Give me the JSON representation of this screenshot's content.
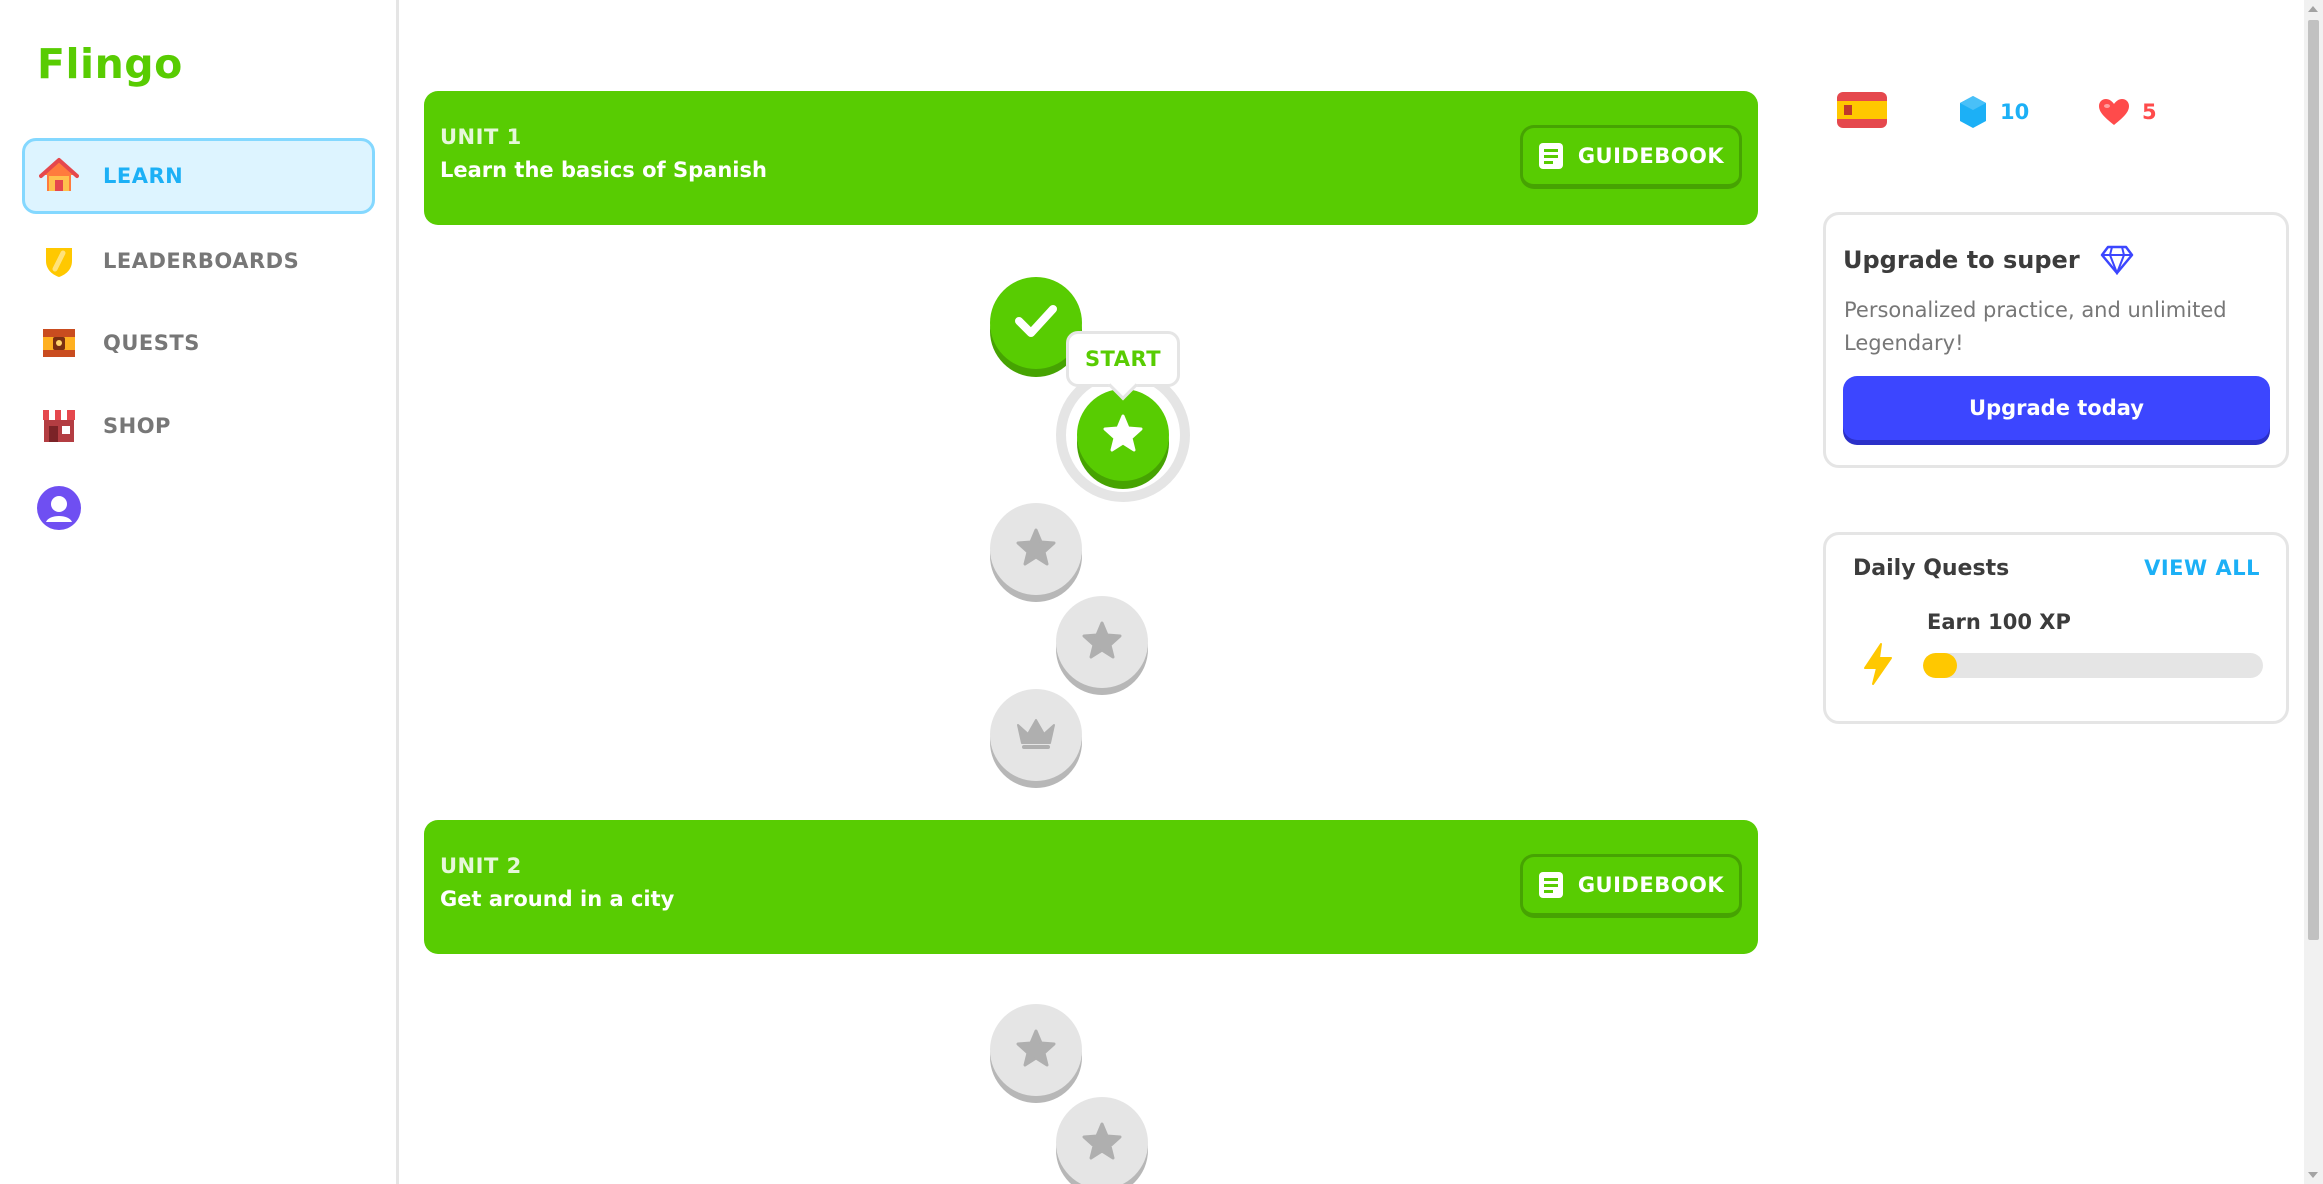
{
  "app": {
    "logo": "Flingo"
  },
  "sidebar": {
    "items": [
      {
        "label": "LEARN",
        "icon": "home-icon",
        "active": true
      },
      {
        "label": "LEADERBOARDS",
        "icon": "shield-icon"
      },
      {
        "label": "QUESTS",
        "icon": "chest-icon"
      },
      {
        "label": "SHOP",
        "icon": "shop-icon"
      },
      {
        "label": "",
        "icon": "profile-icon"
      }
    ]
  },
  "units": [
    {
      "title": "UNIT 1",
      "subtitle": "Learn the basics of Spanish",
      "guidebook_label": "GUIDEBOOK",
      "lessons": [
        "completed",
        "current",
        "locked",
        "locked",
        "locked-crown"
      ]
    },
    {
      "title": "UNIT 2",
      "subtitle": "Get around in a city",
      "guidebook_label": "GUIDEBOOK",
      "lessons": [
        "locked",
        "locked"
      ]
    }
  ],
  "start_tooltip": "START",
  "stats": {
    "language_flag": "spain-flag-icon",
    "gems": "10",
    "hearts": "5",
    "colors": {
      "gems": "#1cb0f6",
      "hearts": "#ff4b4b"
    }
  },
  "super_card": {
    "title": "Upgrade to super",
    "description": "Personalized practice, and unlimited Legendary!",
    "button_label": "Upgrade today",
    "accent": "#3c46ff"
  },
  "daily_quests": {
    "title": "Daily Quests",
    "view_all_label": "VIEW ALL",
    "quests": [
      {
        "label": "Earn 100 XP",
        "progress": 0.1,
        "icon": "lightning-icon"
      }
    ]
  },
  "colors": {
    "brand": "#58cc02",
    "accent_blue": "#1cb0f6"
  }
}
